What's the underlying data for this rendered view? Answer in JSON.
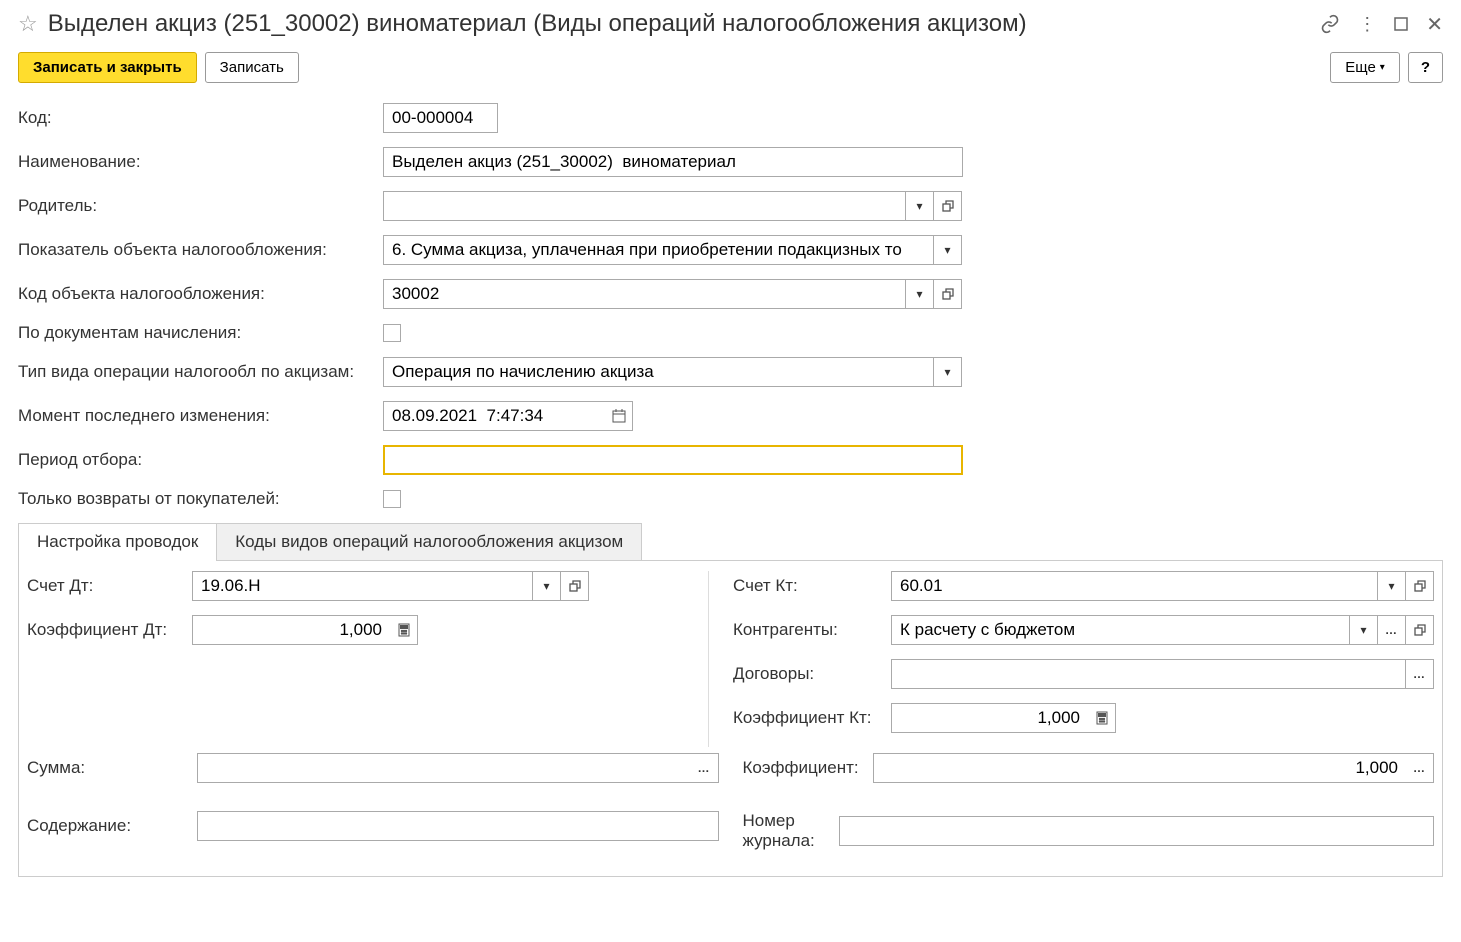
{
  "header": {
    "title": "Выделен акциз (251_30002)  виноматериал (Виды операций налогообложения акцизом)"
  },
  "toolbar": {
    "save_close": "Записать и закрыть",
    "save": "Записать",
    "more": "Еще",
    "help": "?"
  },
  "labels": {
    "code": "Код:",
    "name": "Наименование:",
    "parent": "Родитель:",
    "indicator": "Показатель объекта налогообложения:",
    "obj_code": "Код объекта налогообложения:",
    "by_docs": "По документам начисления:",
    "op_type": "Тип вида операции налогообл по акцизам:",
    "last_change": "Момент последнего изменения:",
    "period": "Период отбора:",
    "returns_only": "Только возвраты от покупателей:"
  },
  "fields": {
    "code": "00-000004",
    "name": "Выделен акциз (251_30002)  виноматериал",
    "parent": "",
    "indicator": "6. Сумма акциза, уплаченная при приобретении подакцизных то",
    "obj_code": "30002",
    "by_docs": false,
    "op_type": "Операция по начислению акциза",
    "last_change": "08.09.2021  7:47:34",
    "period": "",
    "returns_only": false
  },
  "tabs": {
    "t1": "Настройка проводок",
    "t2": "Коды видов операций налогообложения акцизом"
  },
  "entries": {
    "labels": {
      "account_dt": "Счет Дт:",
      "coef_dt": "Коэффициент Дт:",
      "account_kt": "Счет Кт:",
      "contr": "Контрагенты:",
      "dog": "Договоры:",
      "coef_kt": "Коэффициент Кт:",
      "sum": "Сумма:",
      "content": "Содержание:",
      "coef": "Коэффициент:",
      "journal": "Номер журнала:"
    },
    "values": {
      "account_dt": "19.06.Н",
      "coef_dt": "1,000",
      "account_kt": "60.01",
      "contr": "К расчету с бюджетом",
      "dog": "",
      "coef_kt": "1,000",
      "sum": "",
      "content": "",
      "coef": "1,000",
      "journal": ""
    }
  }
}
